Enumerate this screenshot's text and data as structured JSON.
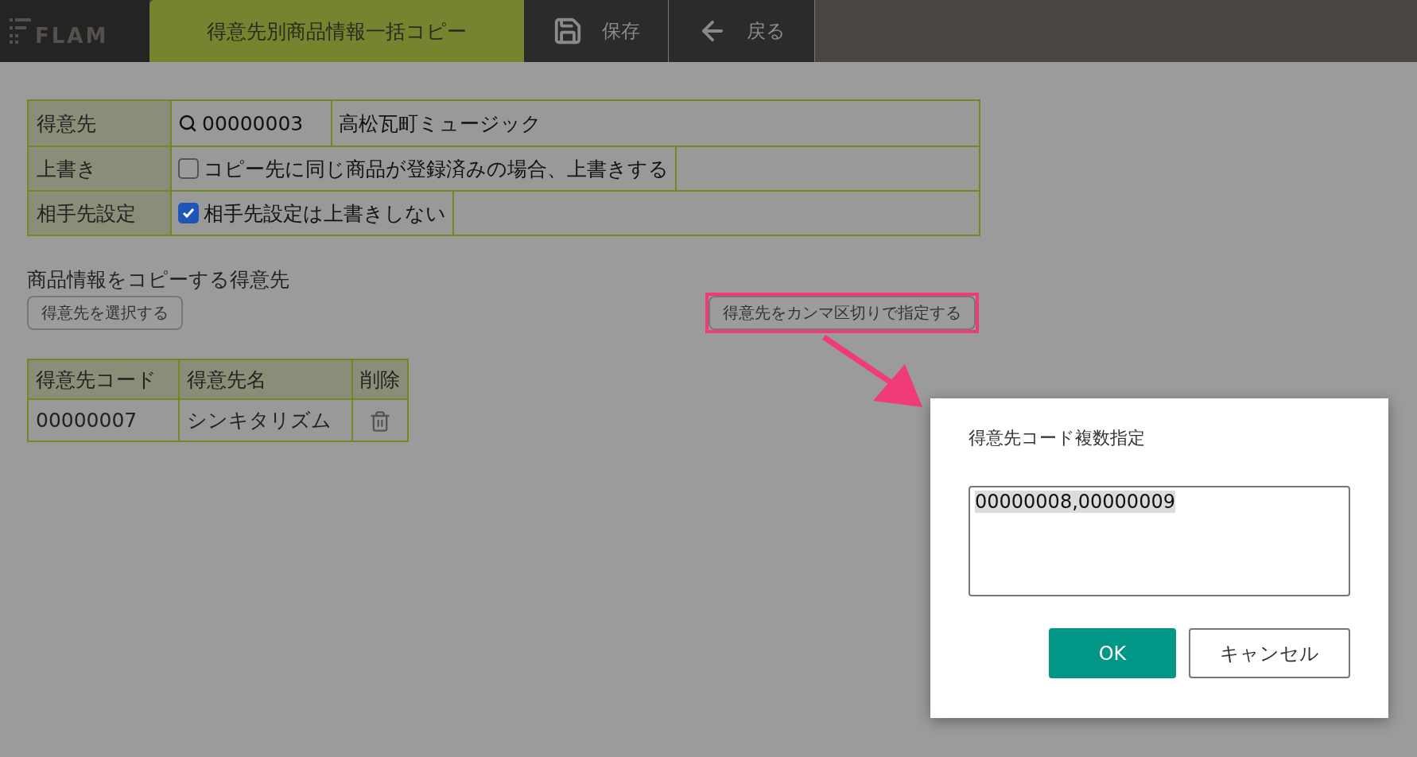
{
  "header": {
    "logo": "FLAM",
    "title": "得意先別商品情報一括コピー",
    "actions": [
      {
        "kind": "save",
        "label": "保存"
      },
      {
        "kind": "back",
        "label": "戻る"
      }
    ]
  },
  "form": [
    {
      "kind": "lookup",
      "label": "得意先",
      "code": "00000003",
      "name": "高松瓦町ミュージック"
    },
    {
      "kind": "checkbox",
      "label": "上書き",
      "text": "コピー先に同じ商品が登録済みの場合、上書きする",
      "checked": false
    },
    {
      "kind": "checkbox",
      "label": "相手先設定",
      "text": "相手先設定は上書きしない",
      "checked": true
    }
  ],
  "targets": {
    "heading": "商品情報をコピーする得意先",
    "select_button": "得意先を選択する",
    "comma_button": "得意先をカンマ区切りで指定する",
    "comma_button_highlighted": true,
    "columns": [
      "得意先コード",
      "得意先名",
      "削除"
    ],
    "rows": [
      {
        "code": "00000007",
        "name": "シンキタリズム"
      }
    ]
  },
  "dialog": {
    "title": "得意先コード複数指定",
    "value": "00000008,00000009",
    "buttons": [
      {
        "kind": "primary",
        "label": "OK"
      },
      {
        "kind": "secondary",
        "label": "キャンセル"
      }
    ]
  }
}
